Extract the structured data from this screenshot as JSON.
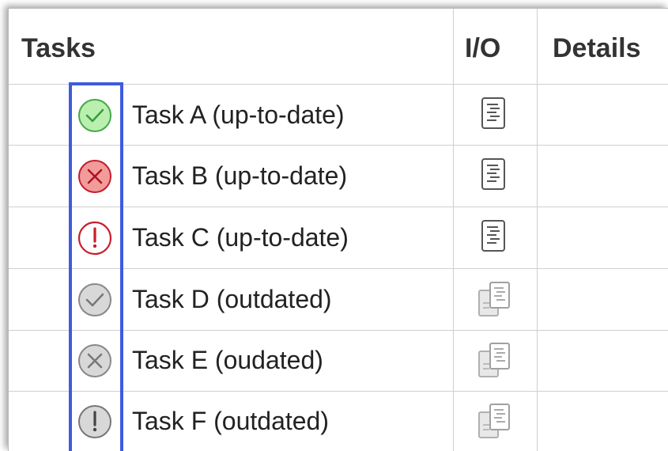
{
  "table": {
    "headers": {
      "tasks": "Tasks",
      "io": "I/O",
      "details": "Details"
    },
    "rows": [
      {
        "label": "Task A (up-to-date)",
        "status_icon": "check-circle-icon",
        "status_color": "#66cc66",
        "state": "up-to-date",
        "io_icon": "log-document-icon"
      },
      {
        "label": "Task B (up-to-date)",
        "status_icon": "x-circle-icon",
        "status_color": "#e86a6a",
        "state": "up-to-date",
        "io_icon": "log-document-icon"
      },
      {
        "label": "Task C (up-to-date)",
        "status_icon": "exclamation-circle-icon",
        "status_color": "#c81e2a",
        "state": "up-to-date",
        "io_icon": "log-document-icon"
      },
      {
        "label": "Task D (outdated)",
        "status_icon": "check-circle-icon",
        "status_color": "#c4c4c4",
        "state": "outdated",
        "io_icon": "stacked-documents-icon"
      },
      {
        "label": "Task E (oudated)",
        "status_icon": "x-circle-icon",
        "status_color": "#c4c4c4",
        "state": "outdated",
        "io_icon": "stacked-documents-icon"
      },
      {
        "label": "Task F (outdated)",
        "status_icon": "exclamation-circle-icon",
        "status_color": "#c4c4c4",
        "state": "outdated",
        "io_icon": "stacked-documents-icon"
      }
    ]
  },
  "highlight": {
    "color": "#3f5bdc"
  }
}
